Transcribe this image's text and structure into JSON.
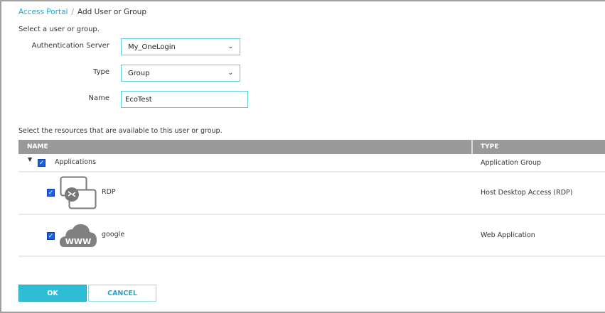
{
  "breadcrumb": {
    "parent": "Access Portal",
    "separator": "/",
    "current": "Add User or Group"
  },
  "form": {
    "intro": "Select a user or group.",
    "auth_server_label": "Authentication Server",
    "auth_server_value": "My_OneLogin",
    "type_label": "Type",
    "type_value": "Group",
    "name_label": "Name",
    "name_value": "EcoTest"
  },
  "resources": {
    "intro": "Select the resources that are available to this user or group.",
    "columns": [
      "NAME",
      "TYPE"
    ],
    "rows": [
      {
        "name": "Applications",
        "type": "Application Group",
        "checked": true,
        "icon": "caret-down-icon"
      },
      {
        "name": "RDP",
        "type": "Host Desktop Access (RDP)",
        "checked": true,
        "icon": "rdp-icon"
      },
      {
        "name": "google",
        "type": "Web Application",
        "checked": true,
        "icon": "www-cloud-icon",
        "icon_text": "WWW"
      }
    ]
  },
  "buttons": {
    "ok": "OK",
    "cancel": "CANCEL"
  },
  "colors": {
    "accent": "#2ebcd6",
    "link": "#2aa6c4",
    "header": "#999999"
  }
}
